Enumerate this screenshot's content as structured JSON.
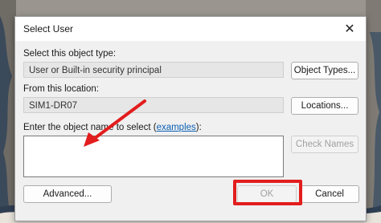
{
  "dialog": {
    "title": "Select User",
    "object_type_label": "Select this object type:",
    "object_type_value": "User or Built-in security principal",
    "object_types_button": "Object Types...",
    "location_label": "From this location:",
    "location_value": "SIM1-DR07",
    "locations_button": "Locations...",
    "enter_name_label": "Enter the object name to select (",
    "examples_link": "examples",
    "enter_name_label_end": "):",
    "check_names_button": "Check Names",
    "advanced_button": "Advanced...",
    "ok_button": "OK",
    "cancel_button": "Cancel"
  },
  "colors": {
    "highlight": "#e21d1d",
    "arrow": "#e21d1d",
    "link": "#0a5fb4"
  }
}
